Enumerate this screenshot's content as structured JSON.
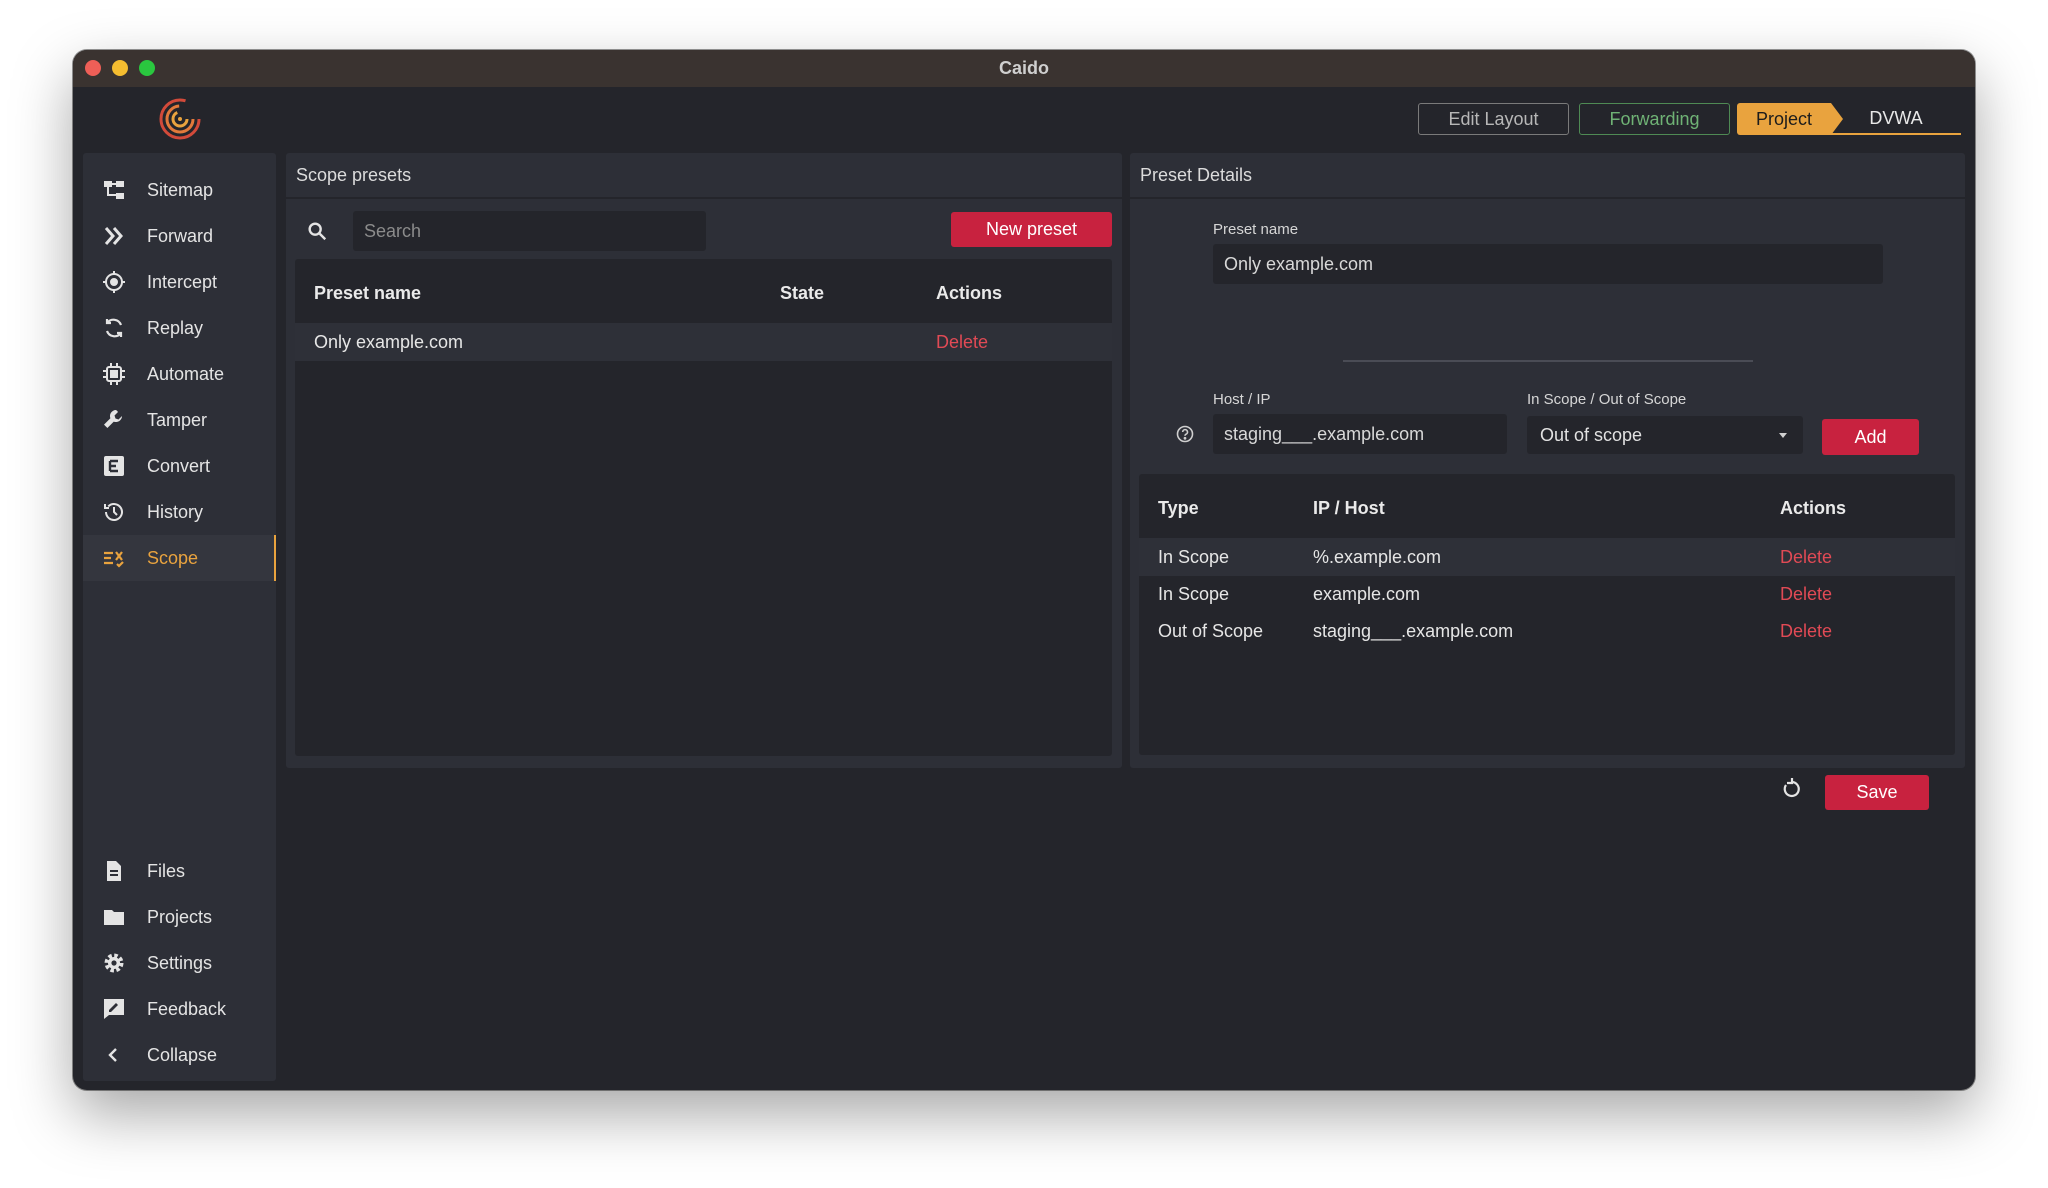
{
  "window": {
    "title": "Caido"
  },
  "topbar": {
    "edit_layout": "Edit Layout",
    "forwarding": "Forwarding",
    "project_label": "Project",
    "project_name": "DVWA"
  },
  "sidebar": {
    "items": [
      {
        "label": "Sitemap",
        "icon": "sitemap-icon"
      },
      {
        "label": "Forward",
        "icon": "forward-icon"
      },
      {
        "label": "Intercept",
        "icon": "intercept-icon"
      },
      {
        "label": "Replay",
        "icon": "replay-icon"
      },
      {
        "label": "Automate",
        "icon": "automate-icon"
      },
      {
        "label": "Tamper",
        "icon": "wrench-icon"
      },
      {
        "label": "Convert",
        "icon": "convert-icon"
      },
      {
        "label": "History",
        "icon": "history-icon"
      },
      {
        "label": "Scope",
        "icon": "scope-icon",
        "active": true
      }
    ],
    "bottom_items": [
      {
        "label": "Files",
        "icon": "file-icon"
      },
      {
        "label": "Projects",
        "icon": "folder-icon"
      },
      {
        "label": "Settings",
        "icon": "gear-icon"
      },
      {
        "label": "Feedback",
        "icon": "feedback-icon"
      },
      {
        "label": "Collapse",
        "icon": "chevron-left-icon"
      }
    ]
  },
  "presets": {
    "header": "Scope presets",
    "search_placeholder": "Search",
    "new_preset": "New preset",
    "columns": {
      "name": "Preset name",
      "state": "State",
      "actions": "Actions"
    },
    "rows": [
      {
        "name": "Only example.com",
        "state": "",
        "action": "Delete"
      }
    ]
  },
  "details": {
    "header": "Preset Details",
    "preset_name_label": "Preset name",
    "preset_name_value": "Only example.com",
    "host_label": "Host / IP",
    "host_value": "staging___.example.com",
    "scope_label": "In Scope / Out of Scope",
    "scope_selected": "Out of scope",
    "add": "Add",
    "columns": {
      "type": "Type",
      "host": "IP / Host",
      "actions": "Actions"
    },
    "rows": [
      {
        "type": "In Scope",
        "host": "%.example.com",
        "action": "Delete"
      },
      {
        "type": "In Scope",
        "host": "example.com",
        "action": "Delete"
      },
      {
        "type": "Out of Scope",
        "host": "staging___.example.com",
        "action": "Delete"
      }
    ],
    "save": "Save"
  },
  "colors": {
    "accent": "#e9a33e",
    "danger": "#c8223f",
    "danger_text": "#e14a55",
    "forwarding": "#6fb275",
    "background": "#24252b",
    "panel": "#2d2f37"
  }
}
